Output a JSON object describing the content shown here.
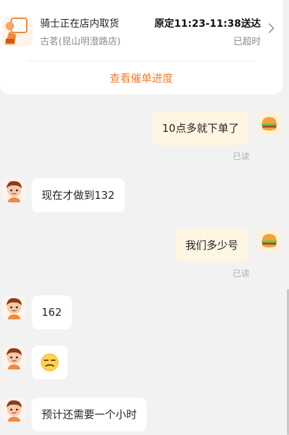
{
  "order": {
    "status": "骑士正在店内取货",
    "store": "古茗(昆山明澄路店)",
    "eta": "原定11:23-11:38送达",
    "overdue": "已超时",
    "progress_link": "查看催单进度"
  },
  "messages": [
    {
      "sender": "user",
      "text": "10点多就下单了",
      "read": "已读"
    },
    {
      "sender": "rider",
      "text": "现在才做到132"
    },
    {
      "sender": "user",
      "text": "我们多少号",
      "read": "已读"
    },
    {
      "sender": "rider",
      "text": "162"
    },
    {
      "sender": "rider",
      "emoji": "unamused-face"
    },
    {
      "sender": "rider",
      "text": "预计还需要一个小时"
    }
  ],
  "colors": {
    "accent": "#ef7a2f",
    "user_bubble": "#fff5e3",
    "rider_bubble": "#ffffff",
    "background": "#f2f2f2"
  }
}
